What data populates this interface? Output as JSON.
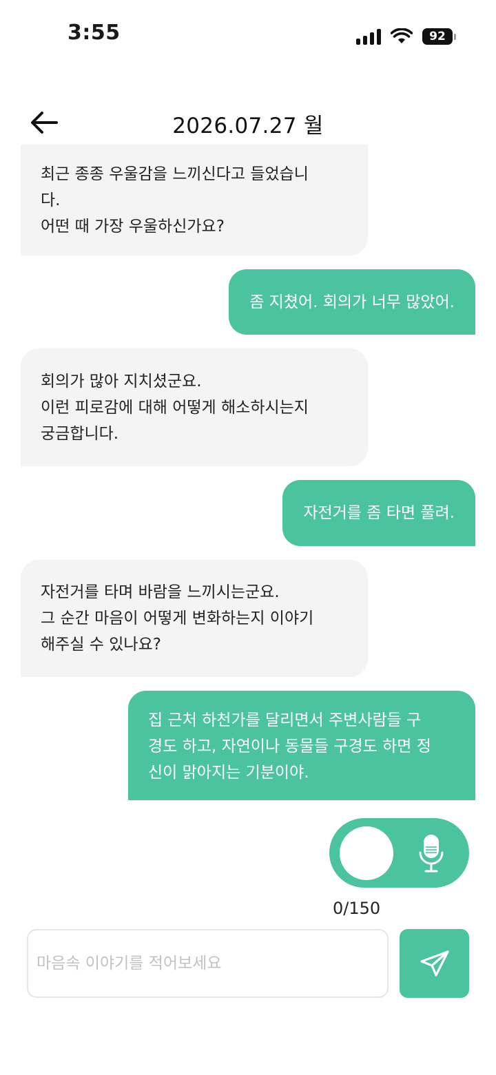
{
  "status_bar": {
    "time": "3:55",
    "battery": "92",
    "icons": [
      "signal-icon",
      "wifi-icon",
      "battery-icon"
    ]
  },
  "header": {
    "date": "2026.07.27 월",
    "back_icon": "back-arrow-icon"
  },
  "messages": [
    {
      "sender": "bot",
      "text": "최근 종종 우울감을 느끼신다고 들었습니\n다.\n어떤 때 가장 우울하신가요?"
    },
    {
      "sender": "user",
      "text": "좀 지쳤어. 회의가 너무 많았어."
    },
    {
      "sender": "bot",
      "text": "회의가 많아 지치셨군요.\n이런 피로감에 대해 어떻게 해소하시는지\n궁금합니다."
    },
    {
      "sender": "user",
      "text": "자전거를 좀 타면 풀려."
    },
    {
      "sender": "bot",
      "text": "자전거를 타며 바람을 느끼시는군요.\n그 순간 마음이 어떻게 변화하는지 이야기\n해주실 수 있나요?"
    },
    {
      "sender": "user",
      "text": "집 근처 하천가를 달리면서 주변사람들 구\n경도 하고, 자연이나 동물들 구경도 하면 정\n신이 맑아지는 기분이야."
    }
  ],
  "composer": {
    "char_count": "0/150",
    "placeholder": "마음속 이야기를 적어보세요",
    "value": "",
    "send_icon": "send-icon",
    "voice_toggle_icon": "microphone-icon"
  },
  "colors": {
    "accent": "#4bc39e",
    "bot_bubble": "#f4f4f5",
    "text": "#222222"
  }
}
